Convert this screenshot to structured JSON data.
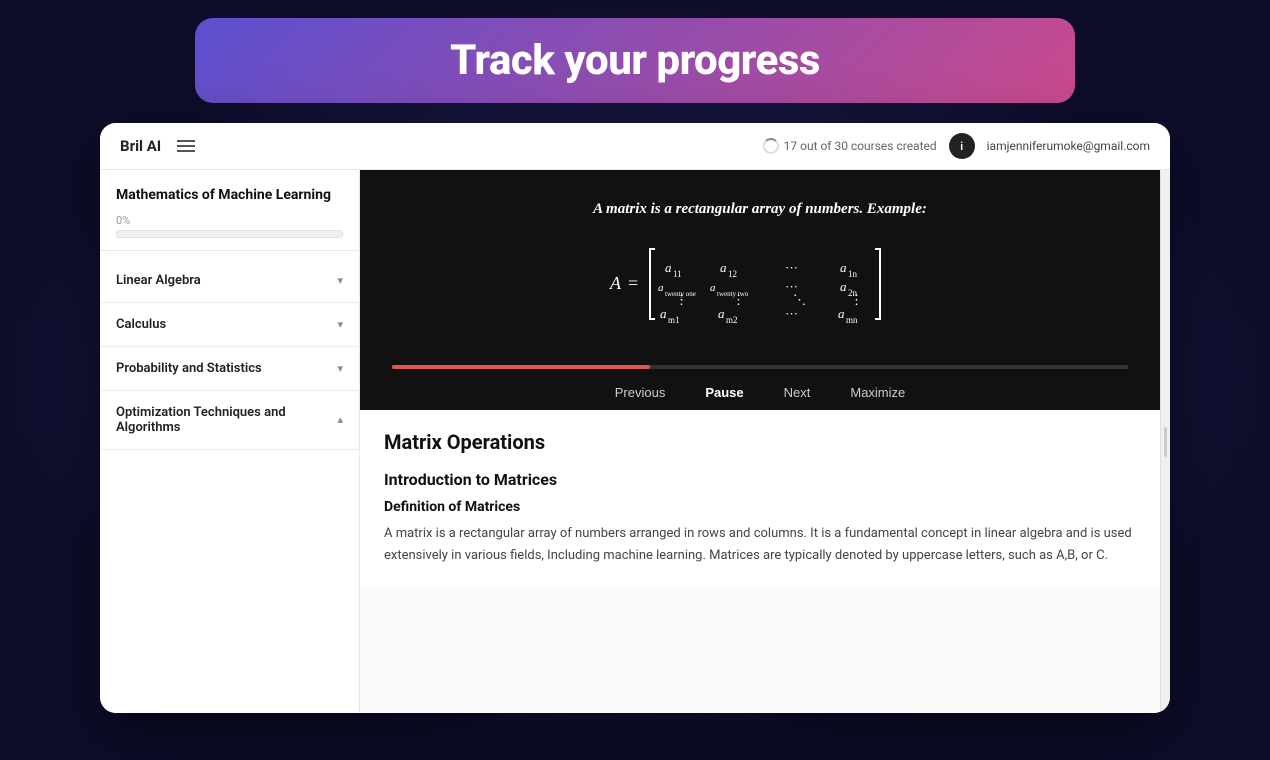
{
  "hero": {
    "title": "Track your progress"
  },
  "topbar": {
    "logo": "Bril AI",
    "courses_count": "17 out of 30 courses created",
    "user_email": "iamjenniferumoke@gmail.com",
    "user_initial": "i"
  },
  "sidebar": {
    "course_title": "Mathematics of Machine Learning",
    "progress_label": "0%",
    "progress_value": 0,
    "sections": [
      {
        "label": "Linear Algebra",
        "chevron": "▾",
        "expanded": false
      },
      {
        "label": "Calculus",
        "chevron": "▾",
        "expanded": false
      },
      {
        "label": "Probability and Statistics",
        "chevron": "▾",
        "expanded": false
      },
      {
        "label": "Optimization Techniques and Algorithms",
        "chevron": "▴",
        "expanded": true
      }
    ]
  },
  "video": {
    "title_text": "A matrix is a rectangular array of numbers. Example:",
    "progress_percent": 35,
    "controls": {
      "previous": "Previous",
      "pause": "Pause",
      "next": "Next",
      "maximize": "Maximize"
    }
  },
  "content": {
    "section_title": "Matrix Operations",
    "intro_title": "Introduction to Matrices",
    "def_title": "Definition of Matrices",
    "def_body": "A matrix is a rectangular array of numbers arranged in rows and columns. It is a fundamental concept in linear algebra and is used extensively in various fields, Including machine learning. Matrices are typically denoted by uppercase letters, such as A,B, or C."
  }
}
